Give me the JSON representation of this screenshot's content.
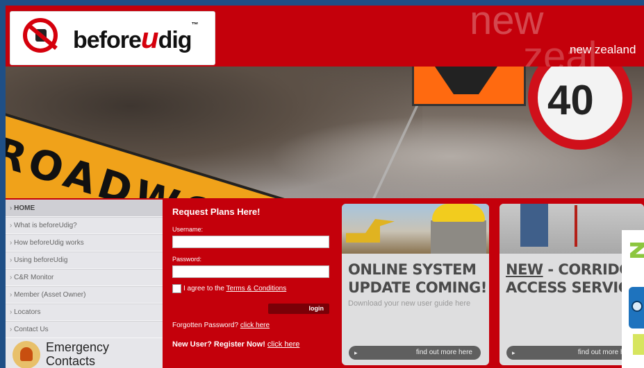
{
  "header": {
    "logo_text_before": "before",
    "logo_text_u": "u",
    "logo_text_dig": "dig",
    "logo_tm": "™",
    "ghost_line1": "new",
    "ghost_line2": "zeal",
    "region_label": "new zealand",
    "brand_color": "#c4000b"
  },
  "banner": {
    "roadsign_text": "ROADWO",
    "speed_text": "40"
  },
  "sidebar": {
    "items": [
      {
        "label": "HOME"
      },
      {
        "label": "What is beforeUdig?"
      },
      {
        "label": "How beforeUdig works"
      },
      {
        "label": "Using beforeUdig"
      },
      {
        "label": "C&R Monitor"
      },
      {
        "label": "Member (Asset Owner)"
      },
      {
        "label": "Locators"
      },
      {
        "label": "Contact Us"
      }
    ],
    "emergency_line1": "Emergency",
    "emergency_line2": "Contacts"
  },
  "login": {
    "title": "Request Plans Here!",
    "username_label": "Username:",
    "password_label": "Password:",
    "agree_prefix": "I agree to the ",
    "terms_link": "Terms & Conditions",
    "login_button": "login",
    "forgot_prefix": "Forgotten Password? ",
    "forgot_link": "click here",
    "register_prefix": "New User? Register Now! ",
    "register_link": "click here"
  },
  "cards": [
    {
      "title_line1": "ONLINE SYSTEM",
      "title_line2": "UPDATE COMING!",
      "subtitle": "Download your new user guide here",
      "button": "find out more here"
    },
    {
      "title_new": "NEW",
      "title_rest": " - CORRIDO",
      "title_line2": "ACCESS SERVIC",
      "button": "find out more here"
    }
  ]
}
